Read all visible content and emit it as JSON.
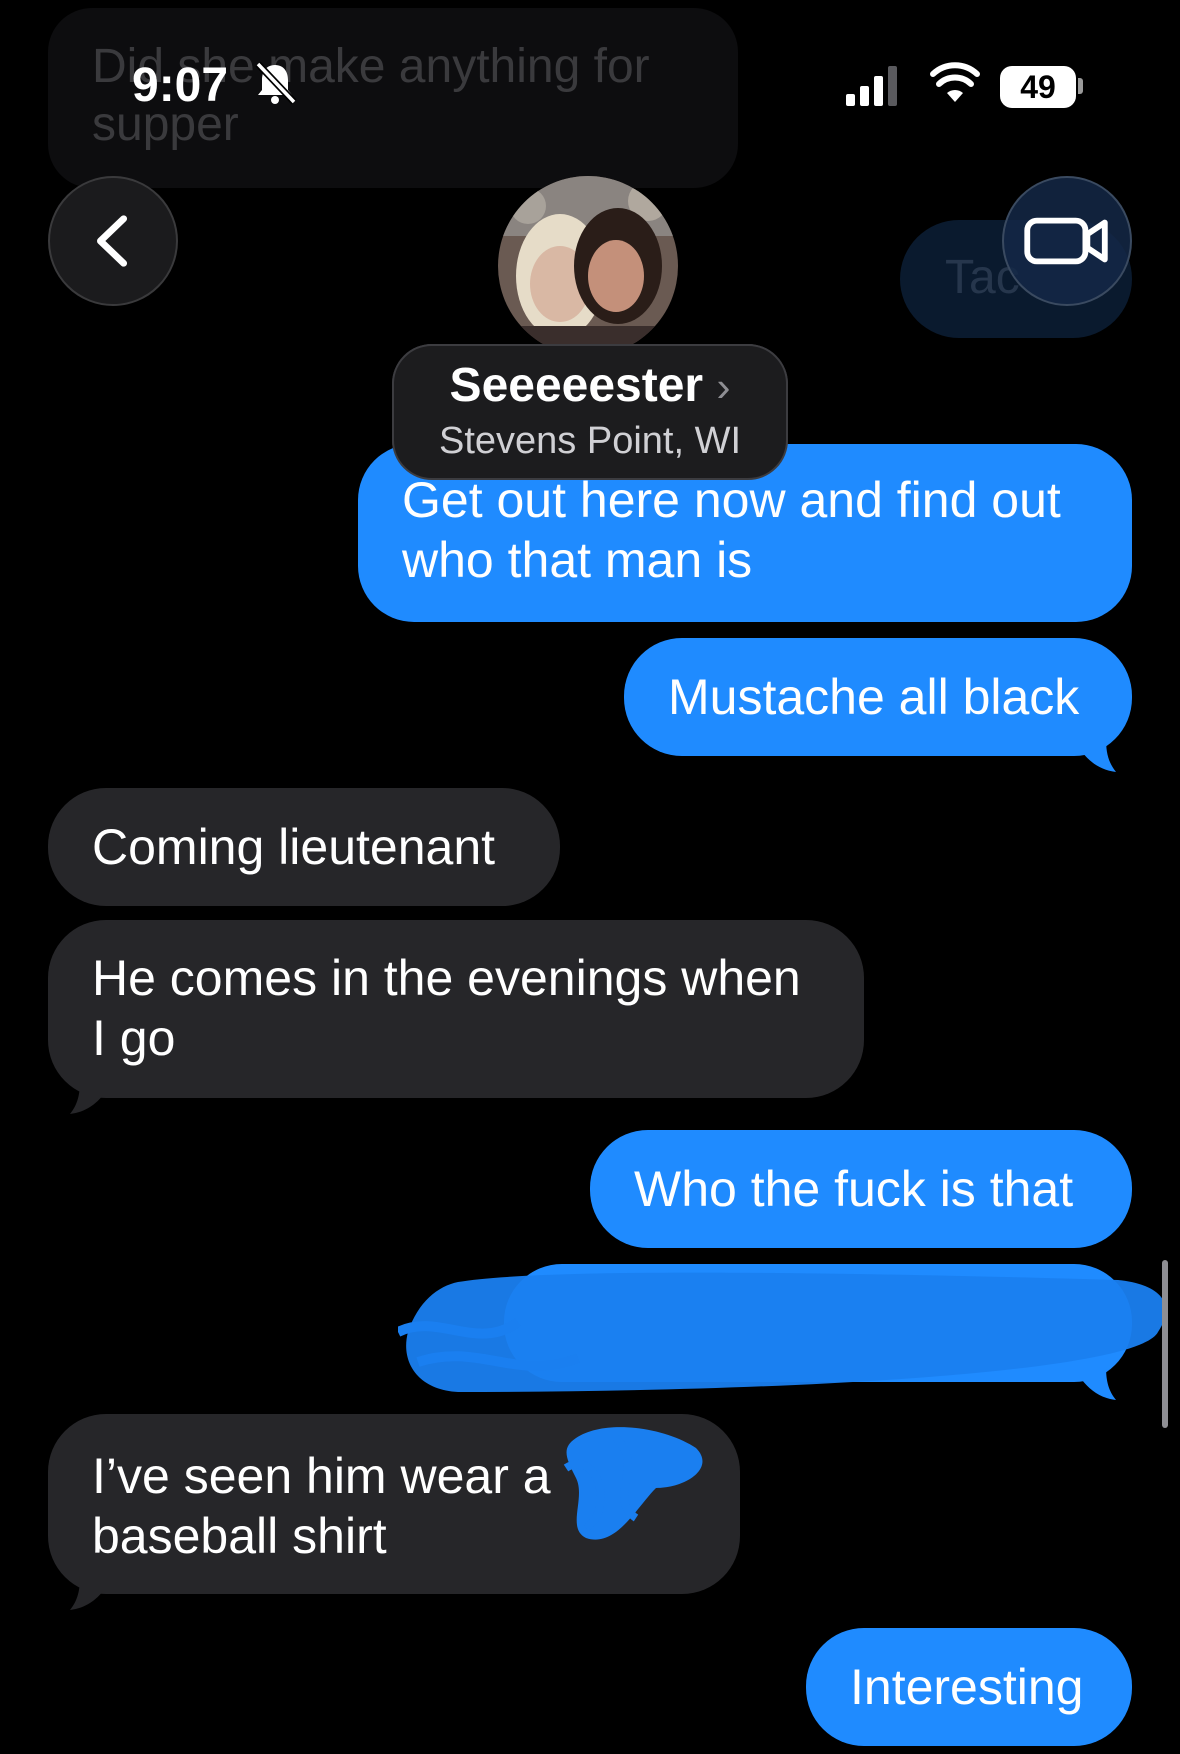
{
  "background_message": {
    "text": "Did she make anything for supper"
  },
  "background_sent": {
    "text": "Tac"
  },
  "status_bar": {
    "time": "9:07",
    "battery": "49",
    "icons": [
      "bell-slash-icon",
      "signal-icon",
      "wifi-icon",
      "battery-icon"
    ]
  },
  "header": {
    "contact_name": "Seeeeester",
    "chevron": "›",
    "location": "Stevens Point, WI",
    "back_icon": "chevron-left-icon",
    "video_icon": "video-camera-icon"
  },
  "messages": [
    {
      "type": "sent",
      "text_line1": "Get out here now and find out",
      "text_line2": "who that man is"
    },
    {
      "type": "sent",
      "text": "Mustache all black"
    },
    {
      "type": "received",
      "text": "Coming lieutenant"
    },
    {
      "type": "received",
      "text_line1": "He comes in the evenings when",
      "text_line2": "I go"
    },
    {
      "type": "sent",
      "text": "Who the fuck is that"
    },
    {
      "type": "sent",
      "text": "",
      "redacted": true
    },
    {
      "type": "received",
      "text_line1": "I’ve seen him wear a",
      "text_line2": "baseball shirt",
      "partially_redacted": true
    },
    {
      "type": "sent",
      "text": "Interesting"
    }
  ],
  "colors": {
    "sent": "#1f8bff",
    "received": "#262629",
    "background": "#000000",
    "scribble": "#1a7ff0"
  }
}
